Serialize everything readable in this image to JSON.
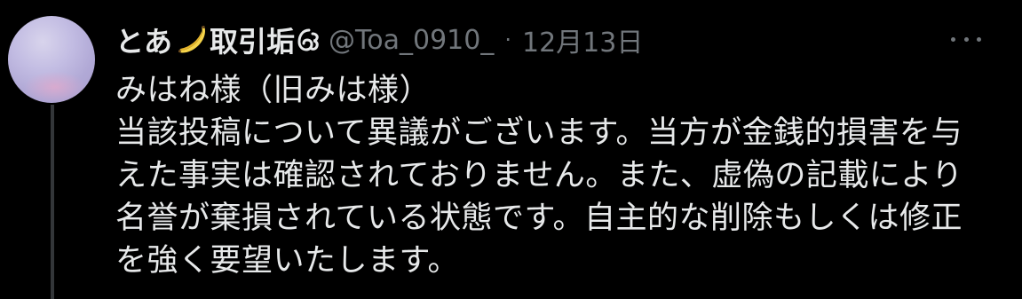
{
  "tweet": {
    "display_name": "とあ",
    "display_name_suffix": "取引垢",
    "display_name_emoji": "banana-icon",
    "handle": "@Toa_0910_",
    "separator": "·",
    "date": "12月13日",
    "text_lines": [
      "みはね様（旧みは様）",
      "当該投稿について異議がございます。当方が金銭的損害を与",
      "えた事実は確認されておりません。また、虚偽の記載により",
      "名誉が棄損されている状態です。自主的な削除もしくは修正",
      "を強く要望いたします。"
    ]
  },
  "colors": {
    "background": "#000000",
    "text_primary": "#e7e9ea",
    "text_secondary": "#71767b",
    "thread_line": "#333639"
  }
}
